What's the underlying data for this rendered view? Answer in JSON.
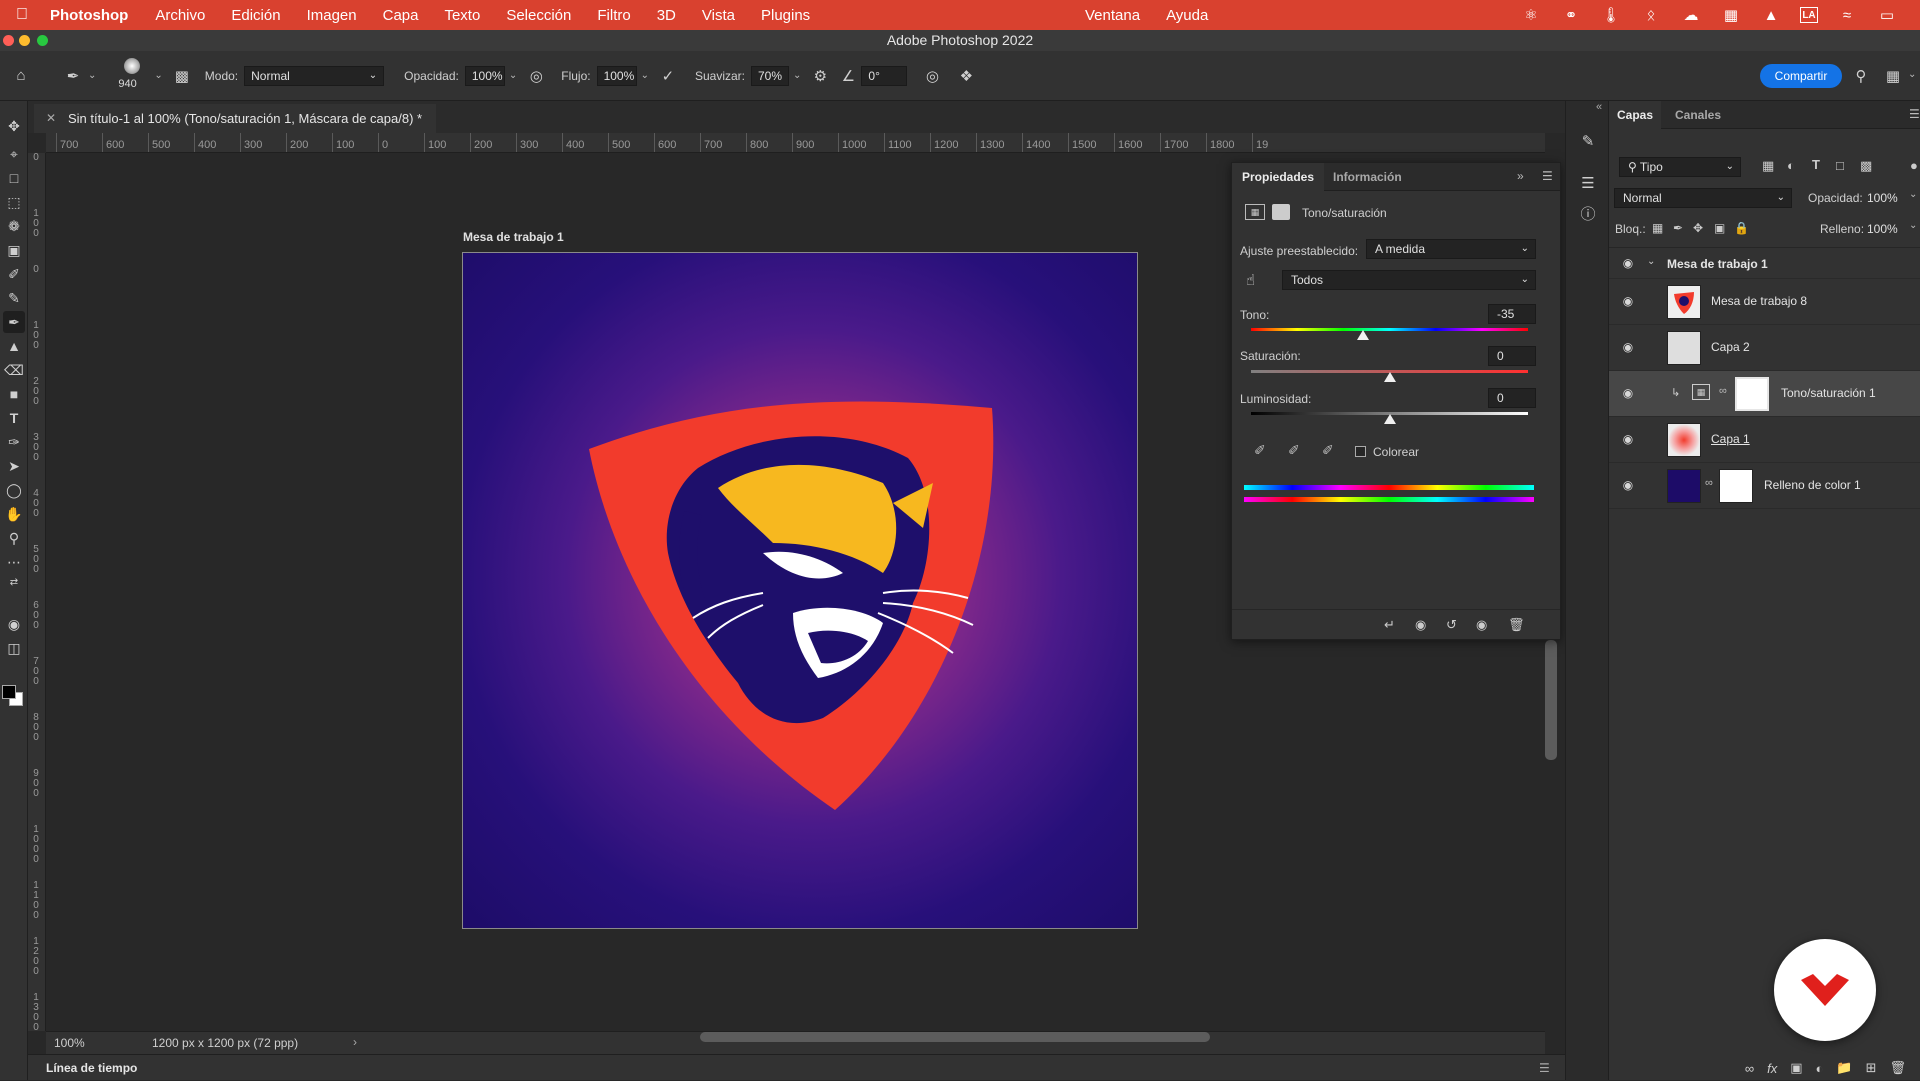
{
  "menubar": {
    "app_name": "Photoshop",
    "items": [
      "Archivo",
      "Edición",
      "Imagen",
      "Capa",
      "Texto",
      "Selección",
      "Filtro",
      "3D",
      "Vista",
      "Plugins"
    ],
    "right_items": [
      "Ventana",
      "Ayuda"
    ],
    "status_icons": [
      "creative-cloud-icon",
      "cc-sync-icon",
      "temperature-icon",
      "bluetooth-icon",
      "cloud-icon",
      "grid-app-icon",
      "acrobat-icon",
      "la-badge-icon",
      "wifi-icon",
      "battery-icon"
    ]
  },
  "window": {
    "title": "Adobe Photoshop 2022"
  },
  "options": {
    "brush_size": "940",
    "mode_label": "Modo:",
    "mode_value": "Normal",
    "opacity_label": "Opacidad:",
    "opacity_value": "100%",
    "flow_label": "Flujo:",
    "flow_value": "100%",
    "smoothing_label": "Suavizar:",
    "smoothing_value": "70%",
    "angle_value": "0°",
    "share_label": "Compartir"
  },
  "document": {
    "tab_title": "Sin título-1 al 100% (Tono/saturación 1, Máscara de capa/8) *",
    "artboard_label": "Mesa de trabajo 1",
    "zoom": "100%",
    "doc_info": "1200 px x 1200 px (72 ppp)"
  },
  "rulers": {
    "top": [
      "700",
      "600",
      "500",
      "400",
      "300",
      "200",
      "100",
      "0",
      "100",
      "200",
      "300",
      "400",
      "500",
      "600",
      "700",
      "800",
      "900",
      "1000",
      "1100",
      "1200",
      "1300",
      "1400",
      "1500",
      "1600",
      "1700",
      "1800",
      "19"
    ],
    "left": [
      "0",
      "100",
      "0",
      "100",
      "200",
      "300",
      "400",
      "500",
      "600",
      "700",
      "800",
      "900",
      "1000",
      "1100",
      "1200",
      "1300"
    ]
  },
  "timeline": {
    "label": "Línea de tiempo"
  },
  "properties": {
    "tabs": [
      "Propiedades",
      "Información"
    ],
    "adjustment_title": "Tono/saturación",
    "preset_label": "Ajuste preestablecido:",
    "preset_value": "A medida",
    "channel_value": "Todos",
    "hue_label": "Tono:",
    "hue_value": "-35",
    "hue_fraction": 0.403,
    "saturation_label": "Saturación:",
    "saturation_value": "0",
    "saturation_fraction": 0.5,
    "lightness_label": "Luminosidad:",
    "lightness_value": "0",
    "lightness_fraction": 0.5,
    "colorize_label": "Colorear"
  },
  "layers": {
    "tabs": [
      "Capas",
      "Canales"
    ],
    "filter_value": "Tipo",
    "blend_mode": "Normal",
    "opacity_label": "Opacidad:",
    "opacity_value": "100%",
    "lock_label": "Bloq.:",
    "fill_label": "Relleno:",
    "fill_value": "100%",
    "group_name": "Mesa de trabajo 1",
    "items": [
      {
        "name": "Mesa de trabajo 8"
      },
      {
        "name": "Capa 2"
      },
      {
        "name": "Tono/saturación 1"
      },
      {
        "name": "Capa 1"
      },
      {
        "name": "Relleno de color 1"
      }
    ]
  },
  "colors": {
    "menubar": "#d9412f",
    "accent": "#1473e6",
    "shield": "#f23b2c",
    "tiger_dark": "#1e0f6b",
    "tiger_yellow": "#f7b81f"
  }
}
